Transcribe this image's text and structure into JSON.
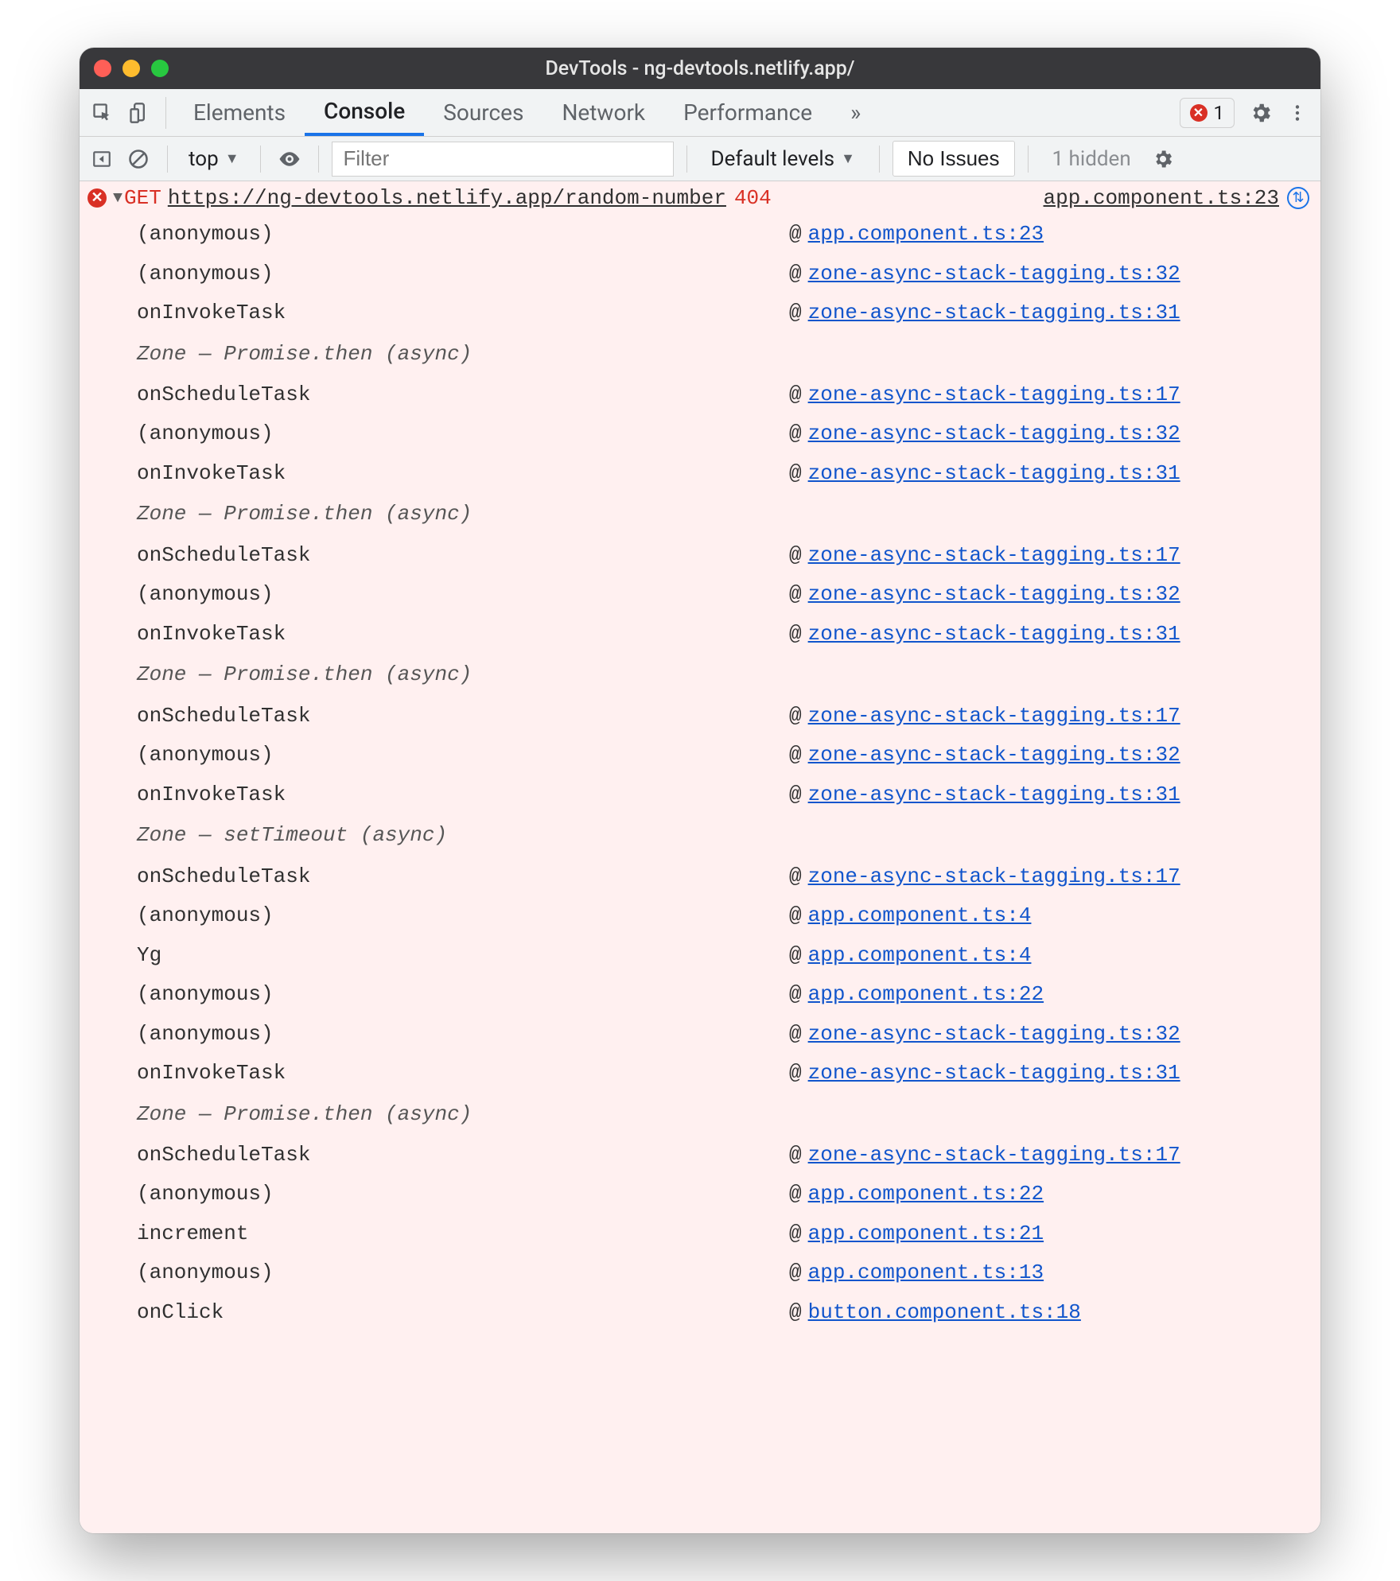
{
  "window": {
    "title": "DevTools - ng-devtools.netlify.app/"
  },
  "tabs": {
    "items": [
      "Elements",
      "Console",
      "Sources",
      "Network",
      "Performance"
    ],
    "active": "Console",
    "more_glyph": "»",
    "error_count": "1"
  },
  "toolbar": {
    "context": "top",
    "filter_placeholder": "Filter",
    "levels_label": "Default levels",
    "issues_label": "No Issues",
    "hidden_label": "1 hidden"
  },
  "error": {
    "method": "GET",
    "url": "https://ng-devtools.netlify.app/random-number",
    "status": "404",
    "source": "app.component.ts:23"
  },
  "trace": [
    {
      "type": "frame",
      "fn": "(anonymous)",
      "src": "app.component.ts:23"
    },
    {
      "type": "frame",
      "fn": "(anonymous)",
      "src": "zone-async-stack-tagging.ts:32"
    },
    {
      "type": "frame",
      "fn": "onInvokeTask",
      "src": "zone-async-stack-tagging.ts:31"
    },
    {
      "type": "async",
      "label": "Zone — Promise.then (async)"
    },
    {
      "type": "frame",
      "fn": "onScheduleTask",
      "src": "zone-async-stack-tagging.ts:17"
    },
    {
      "type": "frame",
      "fn": "(anonymous)",
      "src": "zone-async-stack-tagging.ts:32"
    },
    {
      "type": "frame",
      "fn": "onInvokeTask",
      "src": "zone-async-stack-tagging.ts:31"
    },
    {
      "type": "async",
      "label": "Zone — Promise.then (async)"
    },
    {
      "type": "frame",
      "fn": "onScheduleTask",
      "src": "zone-async-stack-tagging.ts:17"
    },
    {
      "type": "frame",
      "fn": "(anonymous)",
      "src": "zone-async-stack-tagging.ts:32"
    },
    {
      "type": "frame",
      "fn": "onInvokeTask",
      "src": "zone-async-stack-tagging.ts:31"
    },
    {
      "type": "async",
      "label": "Zone — Promise.then (async)"
    },
    {
      "type": "frame",
      "fn": "onScheduleTask",
      "src": "zone-async-stack-tagging.ts:17"
    },
    {
      "type": "frame",
      "fn": "(anonymous)",
      "src": "zone-async-stack-tagging.ts:32"
    },
    {
      "type": "frame",
      "fn": "onInvokeTask",
      "src": "zone-async-stack-tagging.ts:31"
    },
    {
      "type": "async",
      "label": "Zone — setTimeout (async)"
    },
    {
      "type": "frame",
      "fn": "onScheduleTask",
      "src": "zone-async-stack-tagging.ts:17"
    },
    {
      "type": "frame",
      "fn": "(anonymous)",
      "src": "app.component.ts:4"
    },
    {
      "type": "frame",
      "fn": "Yg",
      "src": "app.component.ts:4"
    },
    {
      "type": "frame",
      "fn": "(anonymous)",
      "src": "app.component.ts:22"
    },
    {
      "type": "frame",
      "fn": "(anonymous)",
      "src": "zone-async-stack-tagging.ts:32"
    },
    {
      "type": "frame",
      "fn": "onInvokeTask",
      "src": "zone-async-stack-tagging.ts:31"
    },
    {
      "type": "async",
      "label": "Zone — Promise.then (async)"
    },
    {
      "type": "frame",
      "fn": "onScheduleTask",
      "src": "zone-async-stack-tagging.ts:17"
    },
    {
      "type": "frame",
      "fn": "(anonymous)",
      "src": "app.component.ts:22"
    },
    {
      "type": "frame",
      "fn": "increment",
      "src": "app.component.ts:21"
    },
    {
      "type": "frame",
      "fn": "(anonymous)",
      "src": "app.component.ts:13"
    },
    {
      "type": "frame",
      "fn": "onClick",
      "src": "button.component.ts:18"
    }
  ]
}
